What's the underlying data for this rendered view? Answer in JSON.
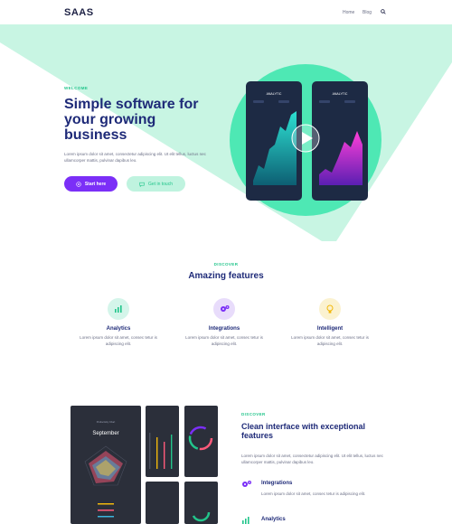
{
  "nav": {
    "logo": "SAAS",
    "links": [
      "Home",
      "Blog"
    ],
    "search_icon": "search-icon"
  },
  "colors": {
    "primary": "#1e2a78",
    "accent_purple": "#7b2ff7",
    "accent_green": "#22c58b",
    "mint": "#c8f5e3",
    "mint_circle": "#4ee8b4",
    "phone": "#1d2a44"
  },
  "hero": {
    "eyebrow": "WELCOME",
    "title": "Simple software for your growing business",
    "text": "Lorem ipsum dolor sit amet, consectetur adipiscing elit. Ut elit tellus, luctus nec ullamcorper mattis, pulvinar dapibus leo.",
    "primary_button": "Start here",
    "secondary_button": "Get in touch",
    "phone_label": "ANALYTIC"
  },
  "features": {
    "eyebrow": "DISCOVER",
    "title": "Amazing features",
    "items": [
      {
        "name": "Analytics",
        "text": "Lorem ipsum dolor sit amet, consec tetur is adipiscing elit.",
        "icon": "bar-chart-icon",
        "bg": "#d4f5ea"
      },
      {
        "name": "Integrations",
        "text": "Lorem ipsum dolor sit amet, consec tetur is adipiscing elit.",
        "icon": "gears-icon",
        "bg": "#e8dcfb"
      },
      {
        "name": "Intelligent",
        "text": "Lorem ipsum dolor sit amet, consec tetur is adipiscing elit.",
        "icon": "lightbulb-icon",
        "bg": "#fbf2d0"
      }
    ]
  },
  "clean": {
    "eyebrow": "DISCOVER",
    "title": "Clean interface with exceptional features",
    "text": "Lorem ipsum dolor sit amet, consectetur adipiscing elit. Ut elit tellus, luctus nec ullamcorper mattis, pulvinar dapibus leo.",
    "dash_month_label": "Productivity Chart",
    "dash_month": "September",
    "items": [
      {
        "name": "Integrations",
        "text": "Lorem ipsum dolor sit amet, consec tetur is adipiscing elit.",
        "icon": "gears-icon"
      },
      {
        "name": "Analytics",
        "text": "",
        "icon": "bar-chart-icon"
      }
    ]
  }
}
